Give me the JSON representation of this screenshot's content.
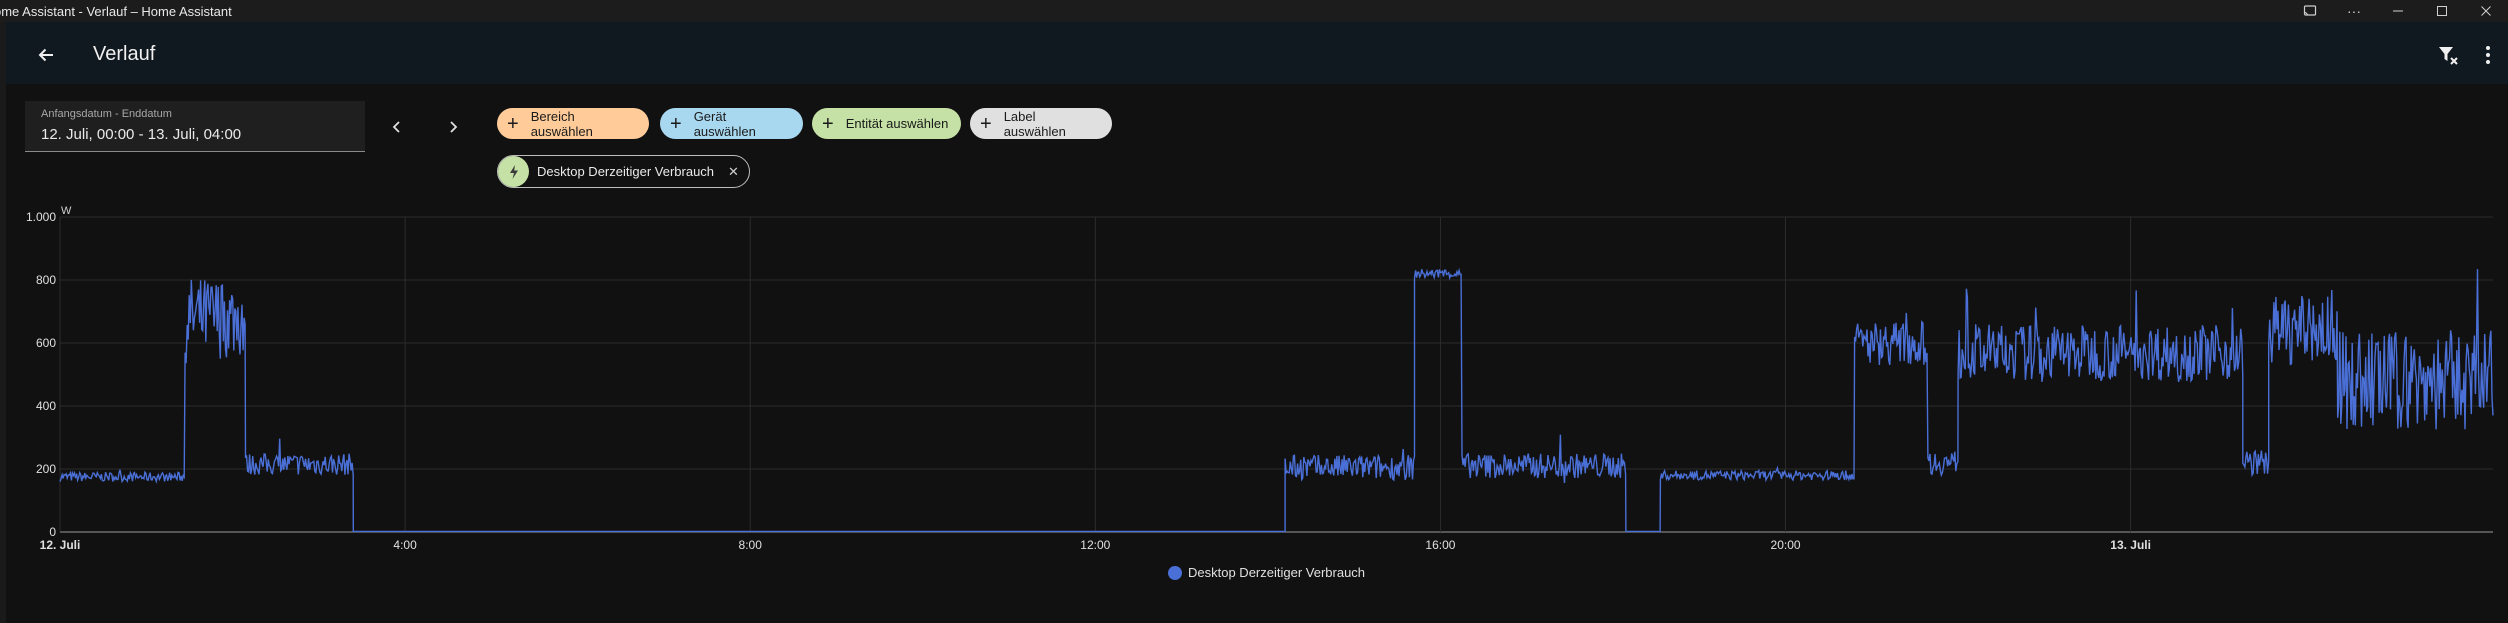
{
  "window": {
    "title": "ome Assistant - Verlauf – Home Assistant",
    "controls": [
      "cast-icon",
      "more-icon",
      "minimize-icon",
      "maximize-icon",
      "close-icon"
    ]
  },
  "header": {
    "title": "Verlauf"
  },
  "date_picker": {
    "label": "Anfangsdatum - Enddatum",
    "value": "12. Juli, 00:00 - 13. Juli, 04:00"
  },
  "targets": {
    "chips": [
      {
        "label": "Bereich auswählen",
        "color": "#ffcc99"
      },
      {
        "label": "Gerät auswählen",
        "color": "#a8d8f0"
      },
      {
        "label": "Entität auswählen",
        "color": "#c5e1a5"
      },
      {
        "label": "Label auswählen",
        "color": "#e0e0e0"
      }
    ],
    "selected_entity": {
      "label": "Desktop Derzeitiger Verbrauch",
      "icon": "flash-icon"
    }
  },
  "colors": {
    "line": "#4a6fd6",
    "grid": "#2c2c2c",
    "background": "#111111"
  },
  "chart_data": {
    "type": "line",
    "ylabel": "W",
    "ylim": [
      0,
      1000
    ],
    "yticks": [
      "0",
      "200",
      "400",
      "600",
      "800",
      "1.000"
    ],
    "xticks": [
      {
        "t": 0,
        "label": "12. Juli"
      },
      {
        "t": 4,
        "label": "4:00"
      },
      {
        "t": 8,
        "label": "8:00"
      },
      {
        "t": 12,
        "label": "12:00"
      },
      {
        "t": 16,
        "label": "16:00"
      },
      {
        "t": 20,
        "label": "20:00"
      },
      {
        "t": 24,
        "label": "13. Juli"
      }
    ],
    "xlim_hours": [
      0,
      28.2
    ],
    "grid": true,
    "legend_position": "bottom-center",
    "series": [
      {
        "name": "Desktop Derzeitiger Verbrauch",
        "segments": [
          {
            "start": 0.0,
            "end": 1.45,
            "base": 175,
            "noise": 15
          },
          {
            "start": 1.45,
            "end": 2.15,
            "base": 680,
            "noise": 130
          },
          {
            "start": 2.15,
            "end": 3.4,
            "base": 215,
            "noise": 35
          },
          {
            "start": 3.4,
            "end": 14.2,
            "base": 2,
            "noise": 0
          },
          {
            "start": 14.2,
            "end": 15.7,
            "base": 205,
            "noise": 40
          },
          {
            "start": 15.7,
            "end": 16.25,
            "base": 820,
            "noise": 15
          },
          {
            "start": 16.25,
            "end": 18.15,
            "base": 210,
            "noise": 40
          },
          {
            "start": 18.15,
            "end": 18.55,
            "base": 2,
            "noise": 0
          },
          {
            "start": 18.55,
            "end": 20.8,
            "base": 180,
            "noise": 15
          },
          {
            "start": 20.8,
            "end": 21.65,
            "base": 600,
            "noise": 70
          },
          {
            "start": 21.65,
            "end": 22.0,
            "base": 220,
            "noise": 40
          },
          {
            "start": 22.0,
            "end": 25.3,
            "base": 570,
            "noise": 90
          },
          {
            "start": 25.3,
            "end": 25.6,
            "base": 220,
            "noise": 40
          },
          {
            "start": 25.6,
            "end": 26.4,
            "base": 640,
            "noise": 110
          },
          {
            "start": 26.4,
            "end": 28.2,
            "base": 480,
            "noise": 160
          }
        ]
      }
    ]
  }
}
